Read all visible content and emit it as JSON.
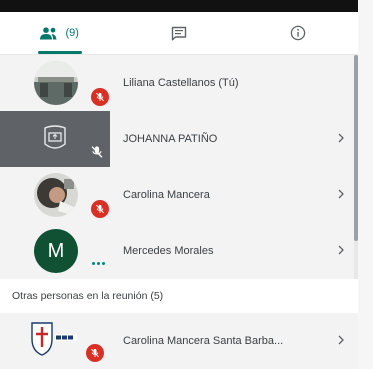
{
  "tabs": [
    {
      "name": "people",
      "icon": "people-icon",
      "count": "(9)",
      "active": true
    },
    {
      "name": "chat",
      "icon": "chat-icon"
    },
    {
      "name": "info",
      "icon": "info-icon"
    }
  ],
  "participants": [
    {
      "name": "Liliana Castellanos (Tú)",
      "avatar": "photo",
      "muted": true,
      "chevron": false
    },
    {
      "name": "JOHANNA PATIÑO",
      "avatar": "presentation",
      "muted": true,
      "chevron": true,
      "selected": true
    },
    {
      "name": "Carolina Mancera",
      "avatar": "photo",
      "muted": true,
      "chevron": true
    },
    {
      "name": "Mercedes Morales",
      "avatar": "letter",
      "initial": "M",
      "muted": false,
      "chevron": true
    }
  ],
  "others_section": {
    "label": "Otras personas en la reunión (5)",
    "participants": [
      {
        "name": "Carolina Mancera Santa Barba...",
        "avatar": "logo",
        "muted": true,
        "chevron": true
      }
    ]
  },
  "colors": {
    "accent": "#00796b",
    "mute": "#d93025",
    "avatar_green": "#0f5132",
    "row_bg": "#f3f3f3"
  }
}
